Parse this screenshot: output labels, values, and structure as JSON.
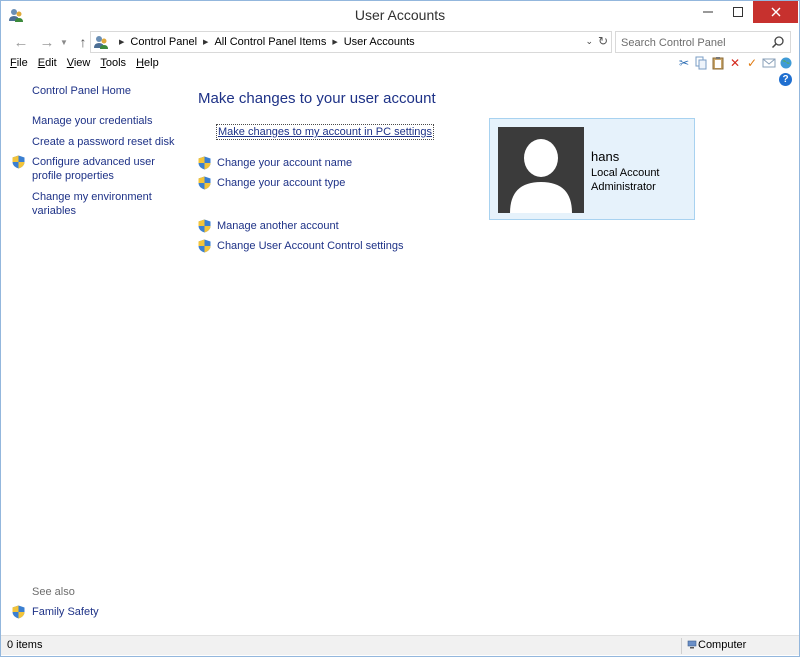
{
  "window": {
    "title": "User Accounts"
  },
  "address": {
    "breadcrumbs": [
      "Control Panel",
      "All Control Panel Items",
      "User Accounts"
    ],
    "search_placeholder": "Search Control Panel"
  },
  "menu": {
    "items": [
      {
        "first": "F",
        "rest": "ile"
      },
      {
        "first": "E",
        "rest": "dit"
      },
      {
        "first": "V",
        "rest": "iew"
      },
      {
        "first": "T",
        "rest": "ools"
      },
      {
        "first": "H",
        "rest": "elp"
      }
    ]
  },
  "sidebar": {
    "home": "Control Panel Home",
    "links": [
      "Manage your credentials",
      "Create a password reset disk",
      "Configure advanced user profile properties",
      "Change my environment variables"
    ],
    "see_also_label": "See also",
    "see_also": [
      "Family Safety"
    ]
  },
  "main": {
    "title": "Make changes to your user account",
    "pc_settings_link": "Make changes to my account in PC settings",
    "links": [
      "Change your account name",
      "Change your account type",
      "Manage another account",
      "Change User Account Control settings"
    ]
  },
  "account": {
    "name": "hans",
    "type": "Local Account",
    "role": "Administrator"
  },
  "status": {
    "items": "0 items",
    "zone": "Computer"
  },
  "colors": {
    "link": "#1e3287",
    "close_button": "#c7312e",
    "tile_bg": "#e6f2fb",
    "tile_border": "#a8d2f0",
    "avatar_bg": "#3b3b3b"
  }
}
